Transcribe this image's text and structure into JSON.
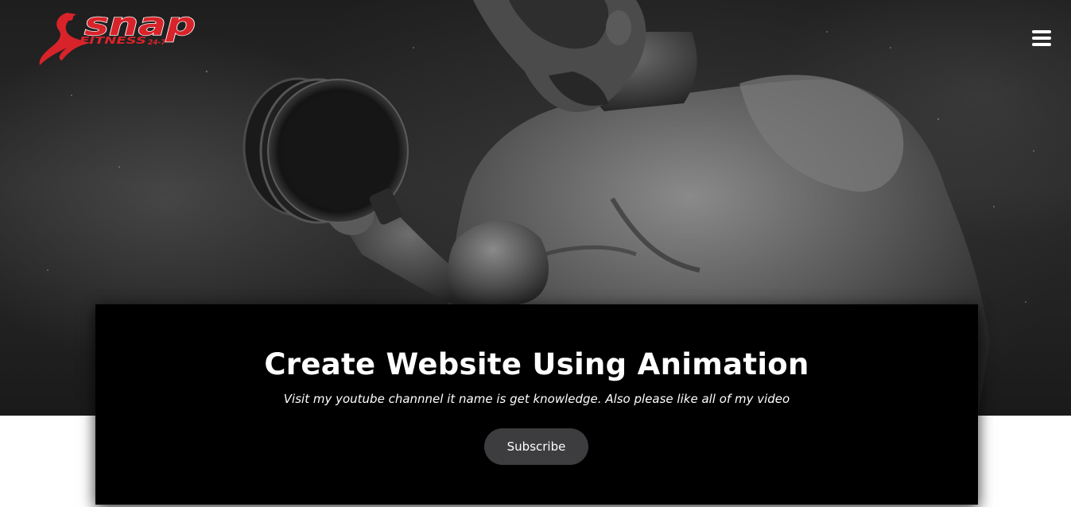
{
  "header": {
    "logo": {
      "brand": "snap",
      "tagline": "FITNESS",
      "suffix": "24-7",
      "brand_color": "#d8232a",
      "tagline_color": "#d8232a"
    },
    "menu_icon": "hamburger-menu-icon"
  },
  "hero": {
    "image_subject": "man lifting a dumbbell, black and white photo"
  },
  "card": {
    "title": "Create Website Using Animation",
    "subtitle": "Visit my youtube channnel it name is get knowledge. Also please like all of my video",
    "button_label": "Subscribe"
  },
  "colors": {
    "card_background": "#000000",
    "button_background": "#3d3d3f",
    "text": "#ffffff"
  }
}
